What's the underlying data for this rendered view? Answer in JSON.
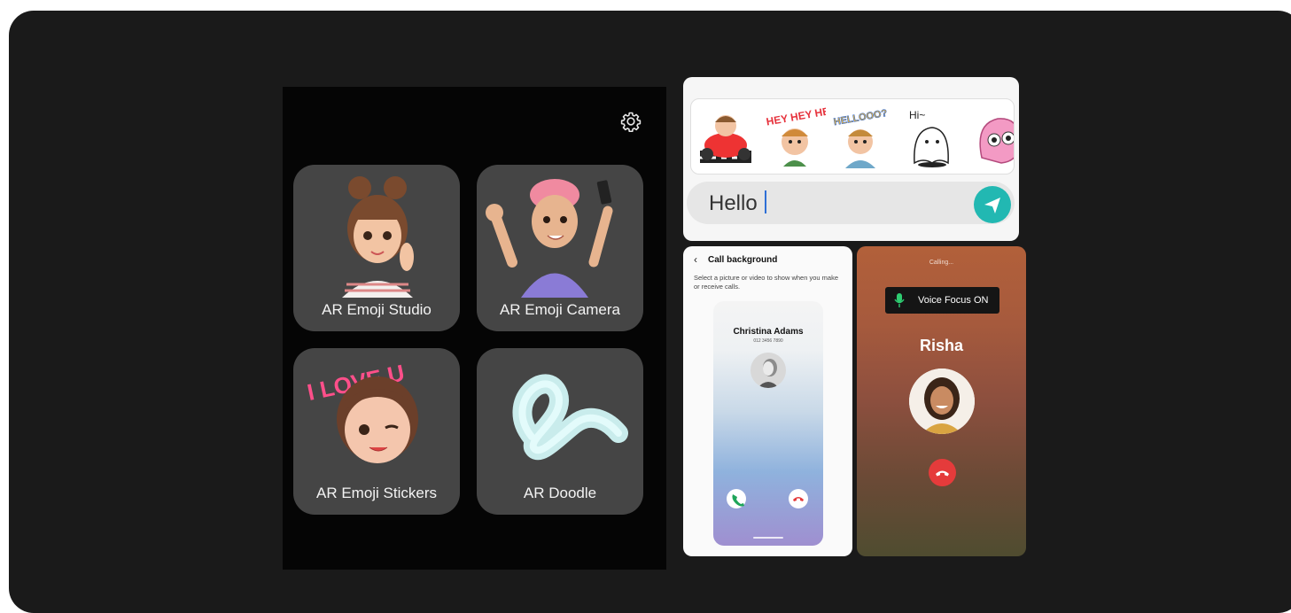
{
  "ar_zone": {
    "settings_icon": "gear-icon",
    "tiles": [
      {
        "label": "AR Emoji Studio"
      },
      {
        "label": "AR Emoji Camera"
      },
      {
        "label": "AR Emoji Stickers"
      },
      {
        "label": "AR Doodle"
      }
    ]
  },
  "chat": {
    "stickers": [
      {
        "name": "race-car-sticker"
      },
      {
        "name": "hey-hey-hey-sticker",
        "text": "HEY HEY HEY"
      },
      {
        "name": "helloooo-sticker",
        "text": "HELLOOO?"
      },
      {
        "name": "hi-ghost-sticker",
        "text": "Hi~"
      },
      {
        "name": "pink-creature-sticker"
      }
    ],
    "message_value": "Hello",
    "send_icon": "send-icon"
  },
  "call_background": {
    "title": "Call background",
    "description": "Select a picture or video to show when you make or receive calls.",
    "preview": {
      "caller_name": "Christina Adams",
      "caller_number": "012 3456 7890"
    }
  },
  "calling_screen": {
    "status": "Calling...",
    "voice_focus": "Voice Focus ON",
    "caller_name": "Risha"
  },
  "colors": {
    "send": "#22b8b2",
    "end_call": "#e53b3b",
    "accept": "#1fa55a",
    "tile_bg": "#454545"
  }
}
